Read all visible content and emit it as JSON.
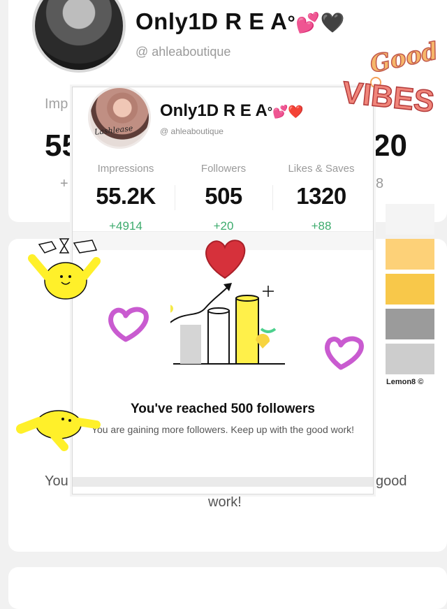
{
  "background": {
    "title": "Only1D R E A",
    "title_deco": "°💕🖤",
    "handle": "@ ahleaboutique",
    "label_left": "Imp",
    "num_left": "55",
    "num_right": "20",
    "plus_left": "+",
    "plus_right": "8",
    "sub_left": "You",
    "sub_right": "good",
    "sub_work": "work!"
  },
  "palette": {
    "colors": [
      "#f4f4f4",
      "#fdd178",
      "#f8c84a",
      "#9b9b9b",
      "#cdcdcd"
    ],
    "brand": "Lemon8 ©"
  },
  "card": {
    "name": "Only1D R E A",
    "name_deco": "°💕❤️",
    "handle": "@ ahleaboutique",
    "avatar_script": "Lashlease",
    "stats": [
      {
        "label": "Impressions",
        "value": "55.2K",
        "delta": "+4914"
      },
      {
        "label": "Followers",
        "value": "505",
        "delta": "+20"
      },
      {
        "label": "Likes & Saves",
        "value": "1320",
        "delta": "+88"
      }
    ],
    "heading": "You've reached 500 followers",
    "subtext": "You are gaining more followers. Keep up with the good work!"
  },
  "stickers": {
    "good": "Good",
    "vibes": "VIBES"
  },
  "colors": {
    "accent_green": "#3dab6d",
    "heart_red": "#d6313b",
    "heart_pink": "#c95bd0",
    "mascot_yellow": "#fff02a",
    "vibes_orange": "#f4a259"
  }
}
